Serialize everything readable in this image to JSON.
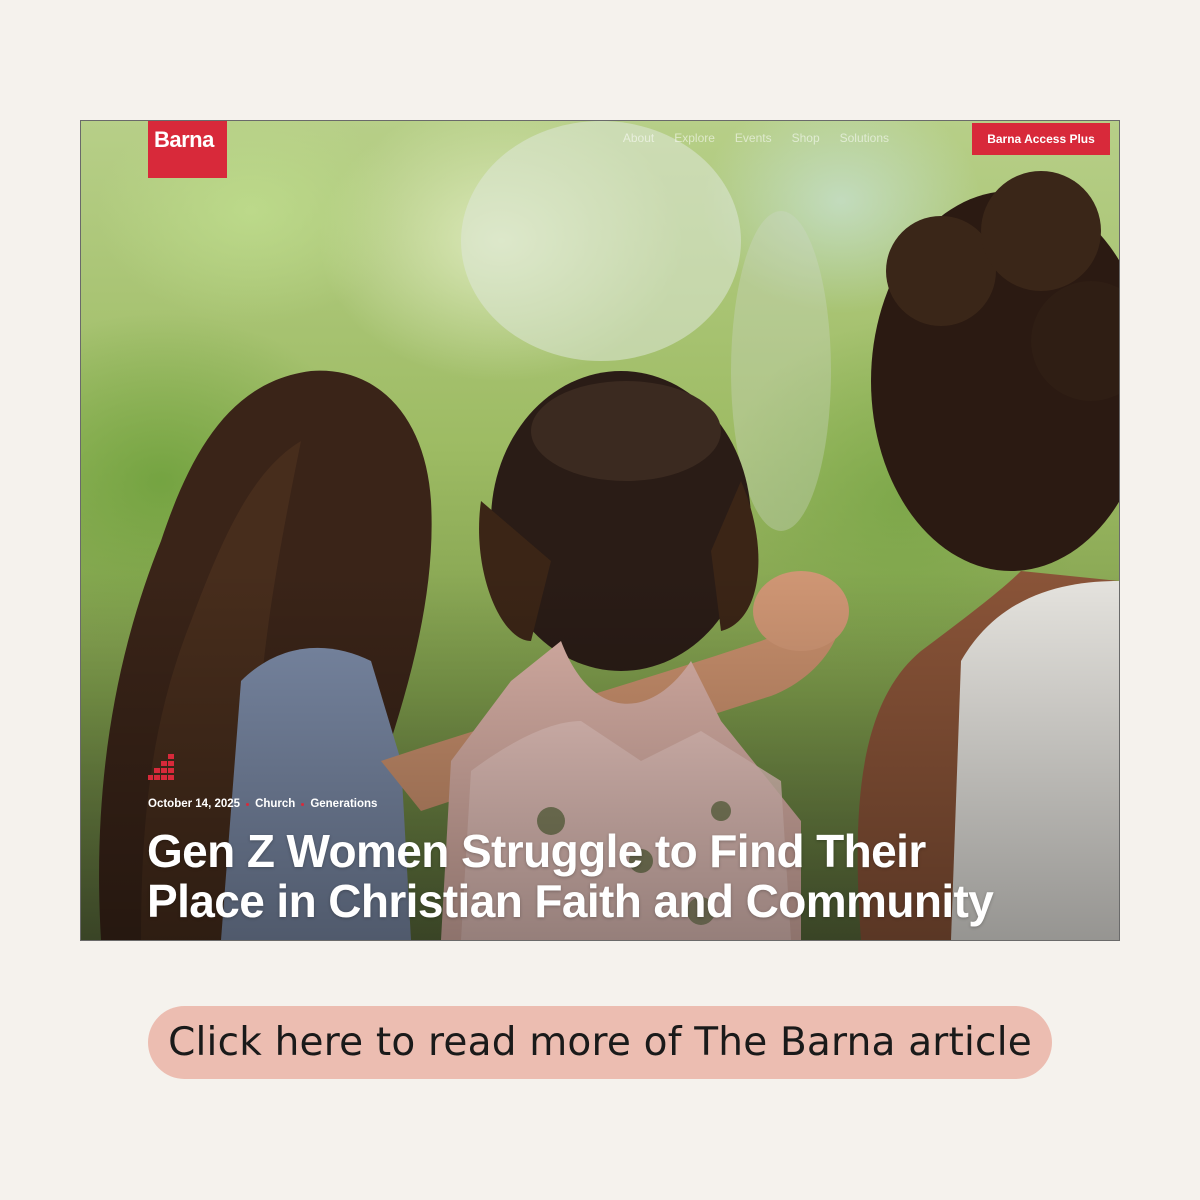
{
  "site": {
    "logo_text": "Barna",
    "brand_color": "#d8293a"
  },
  "nav": {
    "items": [
      "About",
      "Explore",
      "Events",
      "Shop",
      "Solutions"
    ],
    "cta_label": "Barna Access Plus"
  },
  "article": {
    "date": "October 14, 2025",
    "tags": [
      "Church",
      "Generations"
    ],
    "headline_line1": "Gen Z Women Struggle to Find Their",
    "headline_line2": "Place in Christian Faith and Community",
    "hero_image": "three-women-from-behind-photo",
    "mark_icon": "barna-stair-icon"
  },
  "link": {
    "label": "Click here to read more of The Barna article",
    "bg_color": "#ecbdb1"
  },
  "page": {
    "background": "#f5f2ed"
  }
}
